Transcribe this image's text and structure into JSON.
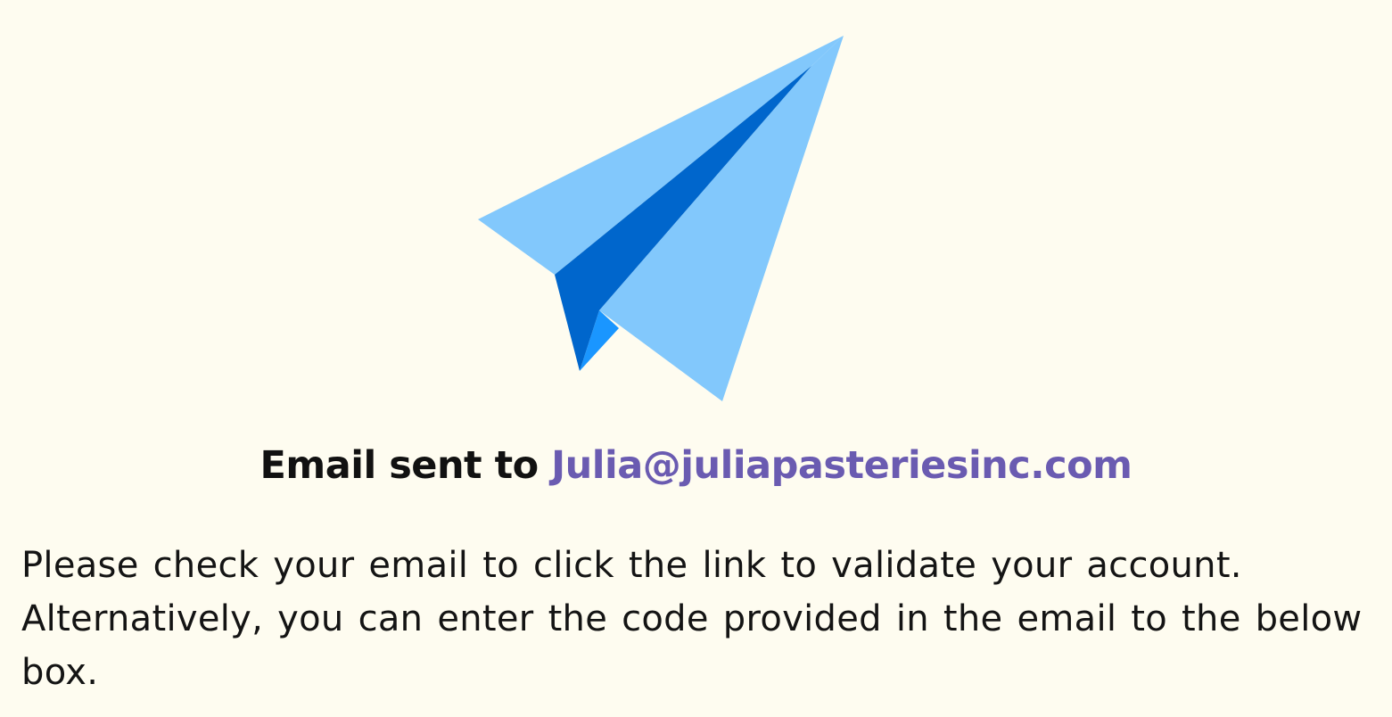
{
  "confirmation": {
    "headline_prefix": "Email sent to",
    "email_address": "Julia@juliapasteriesinc.com",
    "message": "Please check your email to click the link to validate your account. Alternatively, you can enter the code provided in the email to the below box."
  },
  "icons": {
    "illustration": "paper-plane-icon"
  },
  "colors": {
    "background": "#fefcf0",
    "email_accent": "#6a5bb1",
    "plane_light": "#82c8fc",
    "plane_dark": "#0066cc",
    "plane_mid": "#1a96ff"
  }
}
